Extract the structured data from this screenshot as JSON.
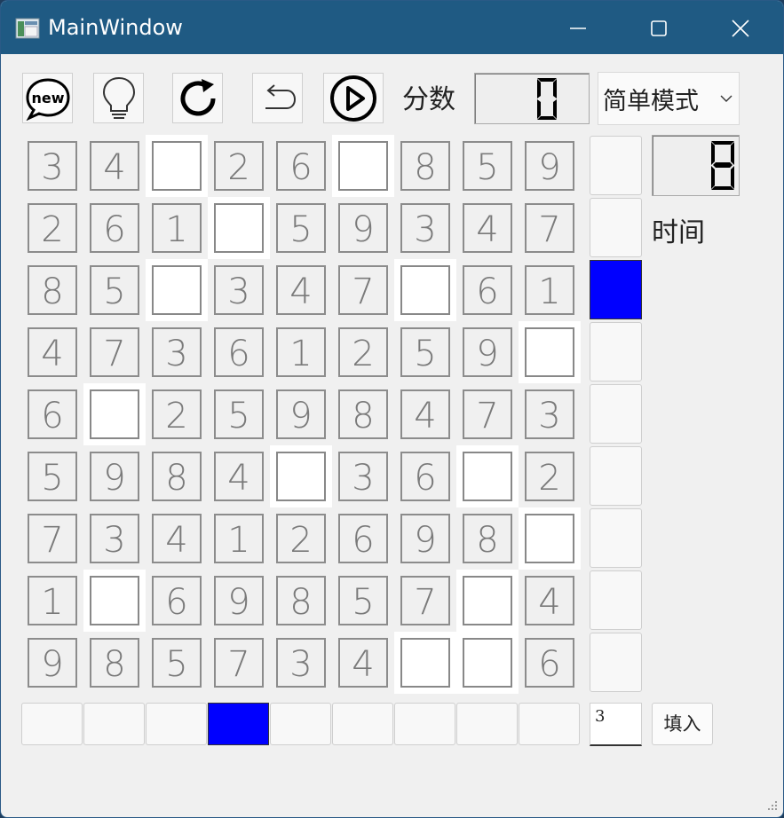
{
  "window": {
    "title": "MainWindow"
  },
  "toolbar": {
    "buttons": [
      {
        "name": "new-game-button",
        "icon": "new-chat-bubble-icon"
      },
      {
        "name": "hint-button",
        "icon": "lightbulb-icon"
      },
      {
        "name": "restart-button",
        "icon": "refresh-icon"
      },
      {
        "name": "undo-button",
        "icon": "undo-arrow-icon"
      },
      {
        "name": "play-button",
        "icon": "play-circle-icon"
      }
    ],
    "score_label": "分数",
    "score_value": "0",
    "mode_selected": "简单模式"
  },
  "timer": {
    "value": "8",
    "label": "时间"
  },
  "board": [
    [
      "3",
      "4",
      "",
      "2",
      "6",
      "",
      "8",
      "5",
      "9"
    ],
    [
      "2",
      "6",
      "1",
      "",
      "5",
      "9",
      "3",
      "4",
      "7"
    ],
    [
      "8",
      "5",
      "",
      "3",
      "4",
      "7",
      "",
      "6",
      "1"
    ],
    [
      "4",
      "7",
      "3",
      "6",
      "1",
      "2",
      "5",
      "9",
      ""
    ],
    [
      "6",
      "",
      "2",
      "5",
      "9",
      "8",
      "4",
      "7",
      "3"
    ],
    [
      "5",
      "9",
      "8",
      "4",
      "",
      "3",
      "6",
      "",
      "2"
    ],
    [
      "7",
      "3",
      "4",
      "1",
      "2",
      "6",
      "9",
      "8",
      ""
    ],
    [
      "1",
      "",
      "6",
      "9",
      "8",
      "5",
      "7",
      "",
      "4"
    ],
    [
      "9",
      "8",
      "5",
      "7",
      "3",
      "4",
      "",
      "",
      "6"
    ]
  ],
  "side_selector": {
    "selected_index": 2,
    "count": 9
  },
  "bottom_selector": {
    "selected_index": 3,
    "count": 9
  },
  "fill": {
    "input_value": "3",
    "button_label": "填入"
  },
  "colors": {
    "titlebar": "#1f5a83",
    "selected": "#0000ff",
    "digit": "#7a7a7a"
  }
}
